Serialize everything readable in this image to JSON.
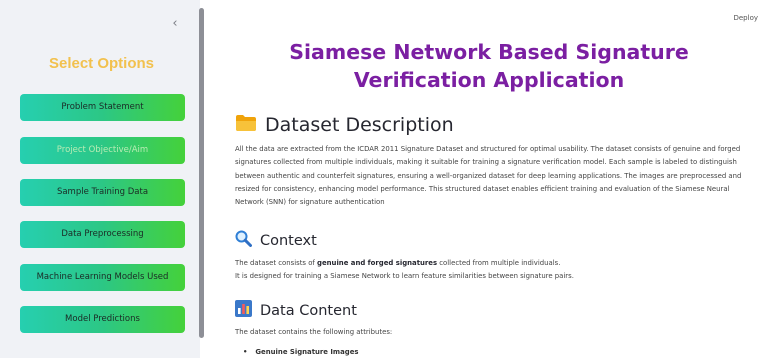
{
  "sidebar": {
    "collapse_glyph": "‹",
    "title": "Select Options",
    "items": [
      {
        "label": "Problem Statement"
      },
      {
        "label": "Project Objective/Aim"
      },
      {
        "label": "Sample Training Data"
      },
      {
        "label": "Data Preprocessing"
      },
      {
        "label": "Machine Learning Models Used"
      },
      {
        "label": "Model Predictions"
      }
    ],
    "active_index": 1
  },
  "header": {
    "deploy_label": "Deploy"
  },
  "main": {
    "title": "Siamese Network Based Signature Verification Application",
    "dataset": {
      "icon": "folder-icon",
      "heading": "Dataset Description",
      "description": "All the data are extracted from the ICDAR 2011 Signature Dataset and structured for optimal usability. The dataset consists of genuine and forged signatures collected from multiple individuals, making it suitable for training a signature verification model. Each sample is labeled to distinguish between authentic and counterfeit signatures, ensuring a well-organized dataset for deep learning applications. The images are preprocessed and resized for consistency, enhancing model performance. This structured dataset enables efficient training and evaluation of the Siamese Neural Network (SNN) for signature authentication"
    },
    "context": {
      "icon": "magnifier-icon",
      "heading": "Context",
      "line1_prefix": "The dataset consists of ",
      "line1_bold": "genuine and forged signatures",
      "line1_suffix": " collected from multiple individuals.",
      "line2": "It is designed for training a Siamese Network to learn feature similarities between signature pairs."
    },
    "content": {
      "icon": "bar-chart-icon",
      "heading": "Data Content",
      "intro": "The dataset contains the following attributes:",
      "bullets": [
        "Genuine Signature Images"
      ]
    }
  },
  "colors": {
    "title_purple": "#7b1fa2",
    "sidebar_title_yellow": "#f2c14e",
    "button_gradient_start": "#26cfb0",
    "button_gradient_end": "#45d13a"
  }
}
